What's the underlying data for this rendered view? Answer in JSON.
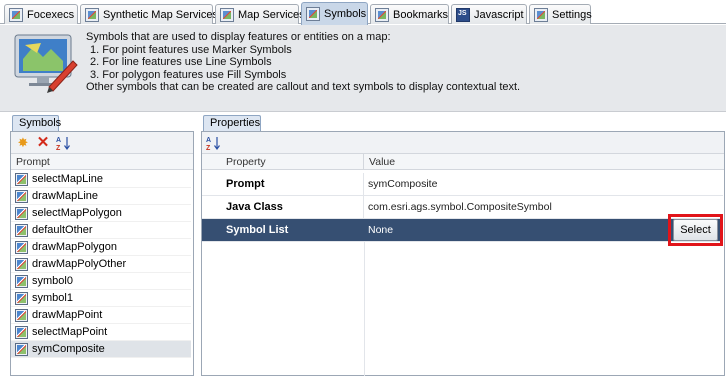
{
  "tabs": [
    {
      "label": "Focexecs",
      "icon": "focexec-icon",
      "active": false
    },
    {
      "label": "Synthetic Map Services",
      "icon": "synthetic-map-icon",
      "active": false
    },
    {
      "label": "Map Services",
      "icon": "map-services-icon",
      "active": false
    },
    {
      "label": "Symbols",
      "icon": "symbols-icon",
      "active": true
    },
    {
      "label": "Bookmarks",
      "icon": "bookmark-icon",
      "active": false
    },
    {
      "label": "Javascript",
      "icon": "javascript-icon",
      "active": false
    },
    {
      "label": "Settings",
      "icon": "settings-icon",
      "active": false
    }
  ],
  "description": {
    "line1": "Symbols that are used to display features or entities on a map:",
    "line2": "1. For point features use Marker Symbols",
    "line3": "2. For line features use Line Symbols",
    "line4": "3. For polygon features use Fill Symbols",
    "line5": "Other symbols that can be created are callout and text symbols to display contextual text.",
    "icon": "map-illustration-icon"
  },
  "symbols_panel": {
    "tab_label": "Symbols",
    "toolbar": {
      "new_icon": "new-star-icon",
      "delete_icon": "delete-x-icon",
      "sort_icon": "sort-az-icon"
    },
    "column_header": "Prompt",
    "items": [
      "selectMapLine",
      "drawMapLine",
      "selectMapPolygon",
      "defaultOther",
      "drawMapPolygon",
      "drawMapPolyOther",
      "symbol0",
      "symbol1",
      "drawMapPoint",
      "selectMapPoint",
      "symComposite"
    ],
    "selected_index": 10
  },
  "properties_panel": {
    "tab_label": "Properties",
    "sort_icon": "sort-az-icon",
    "column_property": "Property",
    "column_value": "Value",
    "rows": [
      {
        "name": "Prompt",
        "value": "symComposite"
      },
      {
        "name": "Java Class",
        "value": "com.esri.ags.symbol.CompositeSymbol"
      },
      {
        "name": "Symbol List",
        "value": "None"
      }
    ],
    "selected_row": 2,
    "select_button_label": "Select",
    "highlight_color": "#e1141a",
    "selection_color": "#364f72"
  }
}
